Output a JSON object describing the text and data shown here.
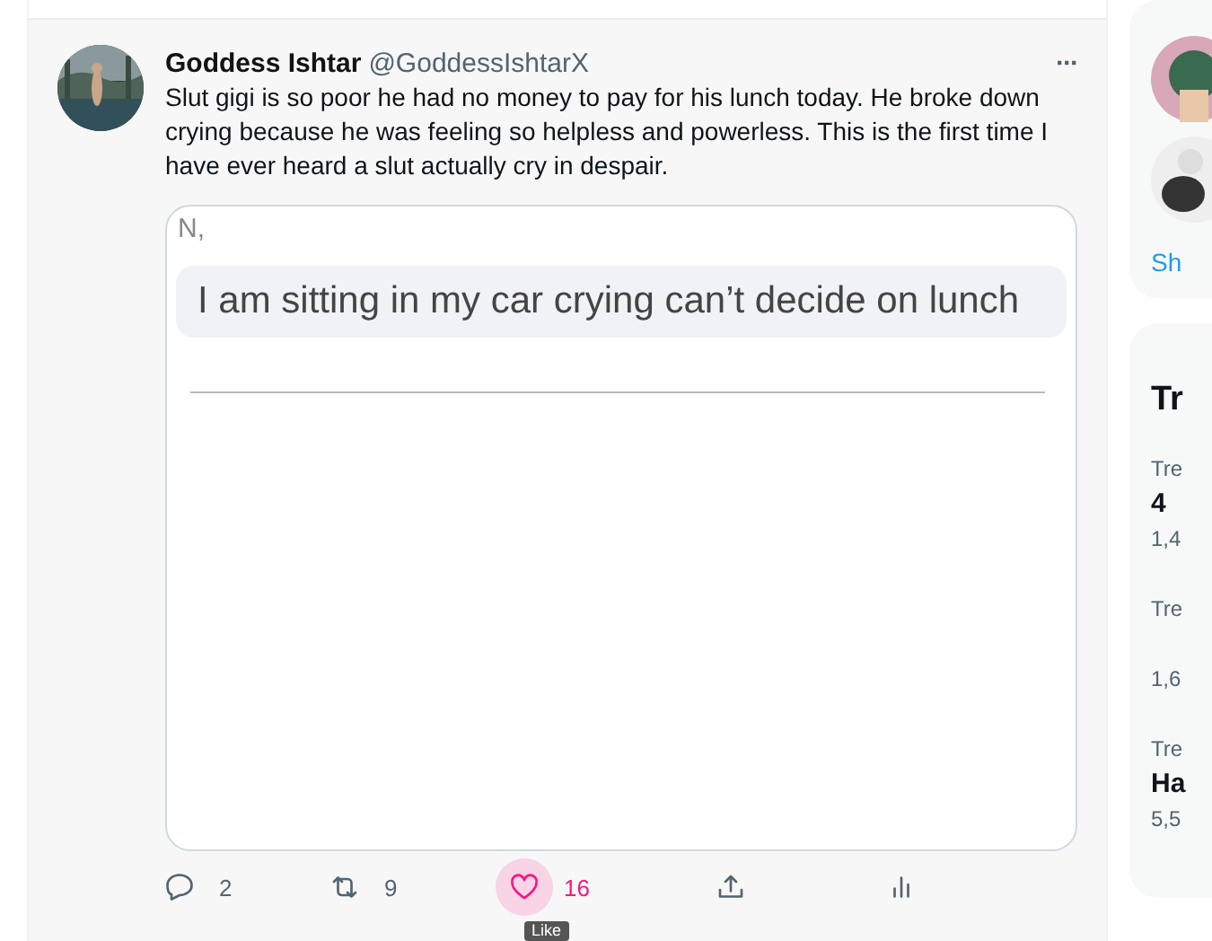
{
  "tweet": {
    "name": "Goddess Ishtar",
    "handle": "@GoddessIshtarX",
    "more": "···",
    "text": "Slut gigi is so poor he had no money to pay for his lunch today. He broke down crying  because  he was feeling so helpless and powerless. This is the first time I have ever heard a slut actually cry in despair.",
    "media": {
      "sender": "N,",
      "message": "I am sitting in my car crying can’t decide on lunch"
    },
    "actions": [
      {
        "kind": "reply",
        "count": "2",
        "liked": false
      },
      {
        "kind": "retweet",
        "count": "9",
        "liked": false
      },
      {
        "kind": "like",
        "count": "16",
        "liked": true
      },
      {
        "kind": "share",
        "liked": false
      },
      {
        "kind": "stats",
        "liked": false
      }
    ],
    "tooltip": "Like"
  },
  "sidebar": {
    "link": "Sh",
    "section_title": "Tr",
    "trends": [
      {
        "context": "Tre",
        "title": "4",
        "count": "1,4"
      },
      {
        "context": "Tre",
        "count": "1,6"
      },
      {
        "context": "Tre",
        "title": "Ha",
        "count": "5,5"
      }
    ]
  }
}
